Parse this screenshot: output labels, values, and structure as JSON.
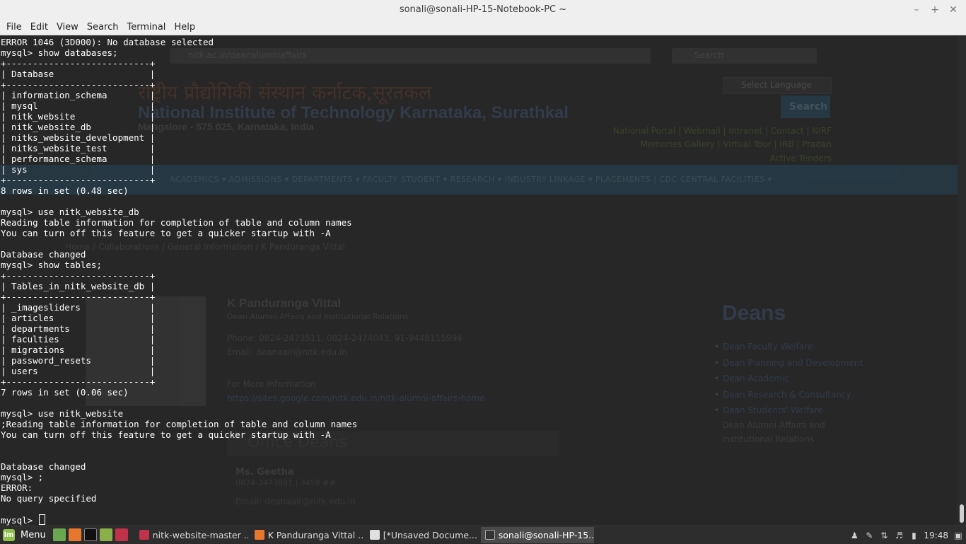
{
  "window": {
    "title": "sonali@sonali-HP-15-Notebook-PC ~",
    "minimize_glyph": "–",
    "maximize_glyph": "+",
    "close_glyph": "✕"
  },
  "menubar": {
    "items": [
      "File",
      "Edit",
      "View",
      "Search",
      "Terminal",
      "Help"
    ]
  },
  "terminal": {
    "lines": [
      "ERROR 1046 (3D000): No database selected",
      "mysql> show databases;",
      "+---------------------------+",
      "| Database                  |",
      "+---------------------------+",
      "| information_schema        |",
      "| mysql                     |",
      "| nitk_website              |",
      "| nitk_website_db           |",
      "| nitks_website_development |",
      "| nitks_website_test        |",
      "| performance_schema        |",
      "| sys                       |",
      "+---------------------------+",
      "8 rows in set (0.48 sec)",
      "",
      "mysql> use nitk_website_db",
      "Reading table information for completion of table and column names",
      "You can turn off this feature to get a quicker startup with -A",
      "",
      "Database changed",
      "mysql> show tables;",
      "+---------------------------+",
      "| Tables_in_nitk_website_db |",
      "+---------------------------+",
      "| _imagesliders             |",
      "| articles                  |",
      "| departments               |",
      "| faculties                 |",
      "| migrations                |",
      "| password_resets           |",
      "| users                     |",
      "+---------------------------+",
      "7 rows in set (0.06 sec)",
      "",
      "mysql> use nitk_website",
      ";Reading table information for completion of table and column names",
      "You can turn off this feature to get a quicker startup with -A",
      "",
      "",
      "Database changed",
      "mysql> ;",
      "ERROR:",
      "No query specified",
      ""
    ],
    "prompt": "mysql> "
  },
  "background_page": {
    "url": "nitk.ac.in/deanalumniaffairs",
    "search_placeholder": "Search",
    "hindi_title": "राष्ट्रीय प्रौद्योगिकी संस्थान कर्नाटक,सूरतकल",
    "title": "National Institute of Technology Karnataka, Surathkal",
    "subtitle": "Mangalore - 575 025, Karnataka, India",
    "language": "Select Language",
    "search_button": "Search",
    "links_row1": "National Portal | Webmail | Intranet | Contact | NIRF",
    "links_row2": "Memories Gallery | Virtual Tour | IRB | Pradan",
    "links_row3": "Active Tenders",
    "nav": "ACADEMICS ▾   ADMISSIONS ▾   DEPARTMENTS ▾   FACULTY   STUDENT ▾   RESEARCH ▾   INDUSTRY LINKAGE ▾   PLACEMENTS | CDC   CENTRAL FACILITIES ▾",
    "breadcrumb": "Home  /  Collaborations  /  General Information  /  K Panduranga Vittal",
    "person_name": "K Panduranga Vittal",
    "person_role": "Dean Alumni Affairs and Institutional Relations",
    "phone": "Phone: 0824-2473511, 0824-2474043, 91-9448115994",
    "email": "Email: deanaair@nitk.edu.in",
    "more_info": "For More Information",
    "more_link": "https://sites.google.com/nitk.edu.in/nitk-alumni-affairs-home",
    "office_heading": "Office Deans",
    "staff_name": "Ms. Geetha",
    "staff_sub": "0824-2473091 | 3458 ##",
    "staff_email": "Email: deanaair@nitk.edu.in",
    "deans_heading": "Deans",
    "deans_list": [
      "Dean Faculty Welfare",
      "Dean Planning and Development",
      "Dean Academic",
      "Dean Research & Consultancy",
      "Dean Students' Welfare"
    ],
    "deans_last": "Dean Alumni Affairs and Institutional Relations"
  },
  "taskbar": {
    "menu_label": "Menu",
    "windows": [
      {
        "label": "nitk-website-master ...",
        "icon_color": "#c0324a"
      },
      {
        "label": "K Panduranga Vittal ...",
        "icon_color": "#e8772e"
      },
      {
        "label": "[*Unsaved Docume...",
        "icon_color": "#e0e0e0"
      },
      {
        "label": "sonali@sonali-HP-15...",
        "icon_color": "#333333"
      }
    ],
    "clock": "19:48"
  },
  "colors": {
    "terminal_bg": "#272727",
    "terminal_fg": "#ffffff",
    "taskbar_bg": "#2d2d2d",
    "menubar_bg": "#efefef"
  }
}
